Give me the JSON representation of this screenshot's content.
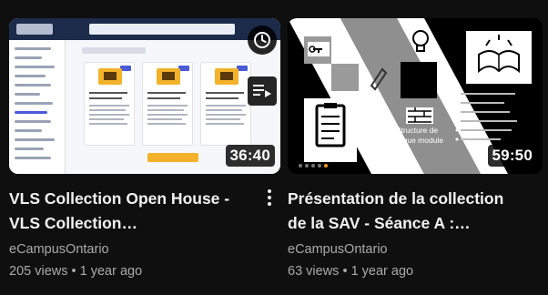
{
  "videos": [
    {
      "title": "VLS Collection Open House - VLS Collection…",
      "title_line1": "VLS Collection Open House -",
      "title_line2": "VLS Collection…",
      "channel": "eCampusOntario",
      "views": "205 views",
      "age": "1 year ago",
      "duration": "36:40"
    },
    {
      "title": "Présentation de la collection de la SAV - Séance A :…",
      "title_line1": "Présentation de la collection",
      "title_line2": "de la SAV - Séance A :…",
      "channel": "eCampusOntario",
      "views": "63 views",
      "age": "1 year ago",
      "duration": "59:50"
    }
  ],
  "meta_separator": "•",
  "thumb2_caption_line1": "Structure de",
  "thumb2_caption_line2": "chaque module",
  "icons": {
    "watch_later": "clock-icon",
    "add_to_queue": "queue-icon",
    "more": "more-vertical-icon"
  }
}
